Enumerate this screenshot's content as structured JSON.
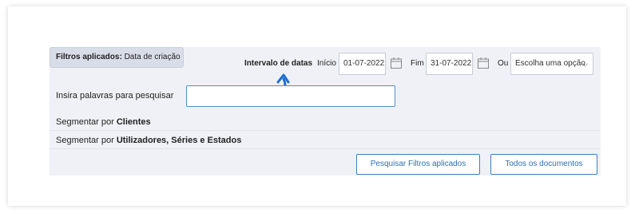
{
  "filters": {
    "applied_label": "Filtros aplicados:",
    "applied_value": "Data de criação"
  },
  "date_range": {
    "title": "Intervalo de datas",
    "start_label": "Início",
    "start_value": "01-07-2022",
    "end_label": "Fim",
    "end_value": "31-07-2022",
    "or_label": "Ou",
    "select_value": "Escolha uma opção"
  },
  "search": {
    "label": "Insira palavras para pesquisar",
    "value": ""
  },
  "segments": [
    {
      "prefix": "Segmentar por",
      "target": "Clientes"
    },
    {
      "prefix": "Segmentar por",
      "target": "Utilizadores, Séries e Estados"
    }
  ],
  "buttons": {
    "search_applied": "Pesquisar Filtros aplicados",
    "all_documents": "Todos os documentos"
  },
  "colors": {
    "accent": "#2d6fb4",
    "panel_bg": "#f0f1f6",
    "annotation_arrow": "#1f6fd1"
  }
}
